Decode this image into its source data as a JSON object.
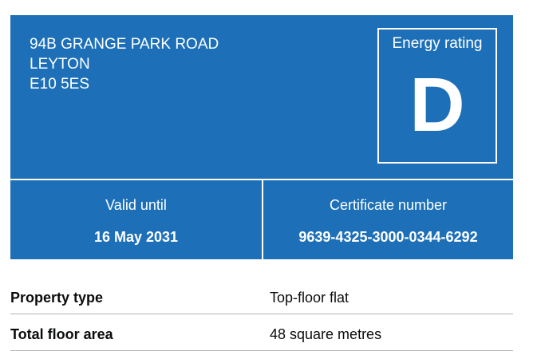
{
  "certificate": {
    "address": [
      "94B GRANGE PARK ROAD",
      "LEYTON",
      "E10 5ES"
    ],
    "energy_rating_label": "Energy rating",
    "energy_rating_value": "D",
    "valid_until_label": "Valid until",
    "valid_until_value": "16 May 2031",
    "certificate_number_label": "Certificate number",
    "certificate_number_value": "9639-4325-3000-0344-6292"
  },
  "summary": [
    {
      "key": "Property type",
      "value": "Top-floor flat"
    },
    {
      "key": "Total floor area",
      "value": "48 square metres"
    }
  ],
  "colors": {
    "brand_blue": "#1d70b8",
    "text": "#0b0c0c",
    "divider": "#b1b4b6"
  }
}
